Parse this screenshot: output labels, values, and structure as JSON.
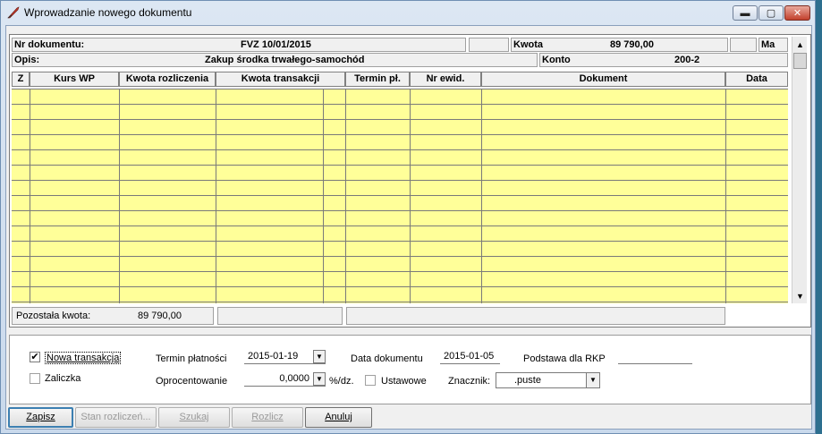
{
  "window": {
    "title": "Wprowadzanie nowego dokumentu",
    "controls": {
      "min": "▬",
      "max": "▢",
      "close": "✕"
    }
  },
  "info": {
    "nr_label": "Nr dokumentu:",
    "nr_value": "FVZ 10/01/2015",
    "kwota_label": "Kwota",
    "kwota_value": "89 790,00",
    "ma_label": "Ma",
    "opis_label": "Opis:",
    "opis_value": "Zakup środka trwałego-samochód",
    "konto_label": "Konto",
    "konto_value": "200-2"
  },
  "columns": [
    "Z",
    "Kurs WP",
    "Kwota rozliczenia",
    "Kwota transakcji",
    "Termin pł.",
    "Nr ewid.",
    "Dokument",
    "Data"
  ],
  "footer": {
    "pozostala_label": "Pozostała kwota:",
    "pozostala_value": "89 790,00"
  },
  "options": {
    "nowa_transakcja": {
      "label": "Nowa transakcja",
      "checked": true
    },
    "zaliczka": {
      "label": "Zaliczka",
      "checked": false
    },
    "termin_label": "Termin płatności",
    "termin_value": "2015-01-19",
    "data_dok_label": "Data dokumentu",
    "data_dok_value": "2015-01-05",
    "podstawa_label": "Podstawa dla RKP",
    "oprocentowanie_label": "Oprocentowanie",
    "oprocentowanie_value": "0,0000",
    "unit": "%/dz.",
    "ustawowe_label": "Ustawowe",
    "znacznik_label": "Znacznik:",
    "znacznik_value": ".puste"
  },
  "buttons": {
    "zapisz": "Zapisz",
    "stan": "Stan rozliczeń...",
    "szukaj": "Szukaj",
    "rozlicz": "Rozlicz",
    "anuluj": "Anuluj"
  },
  "colors": {
    "grid_yellow": "#ffff99",
    "title_gradient": "#dce7f3"
  }
}
